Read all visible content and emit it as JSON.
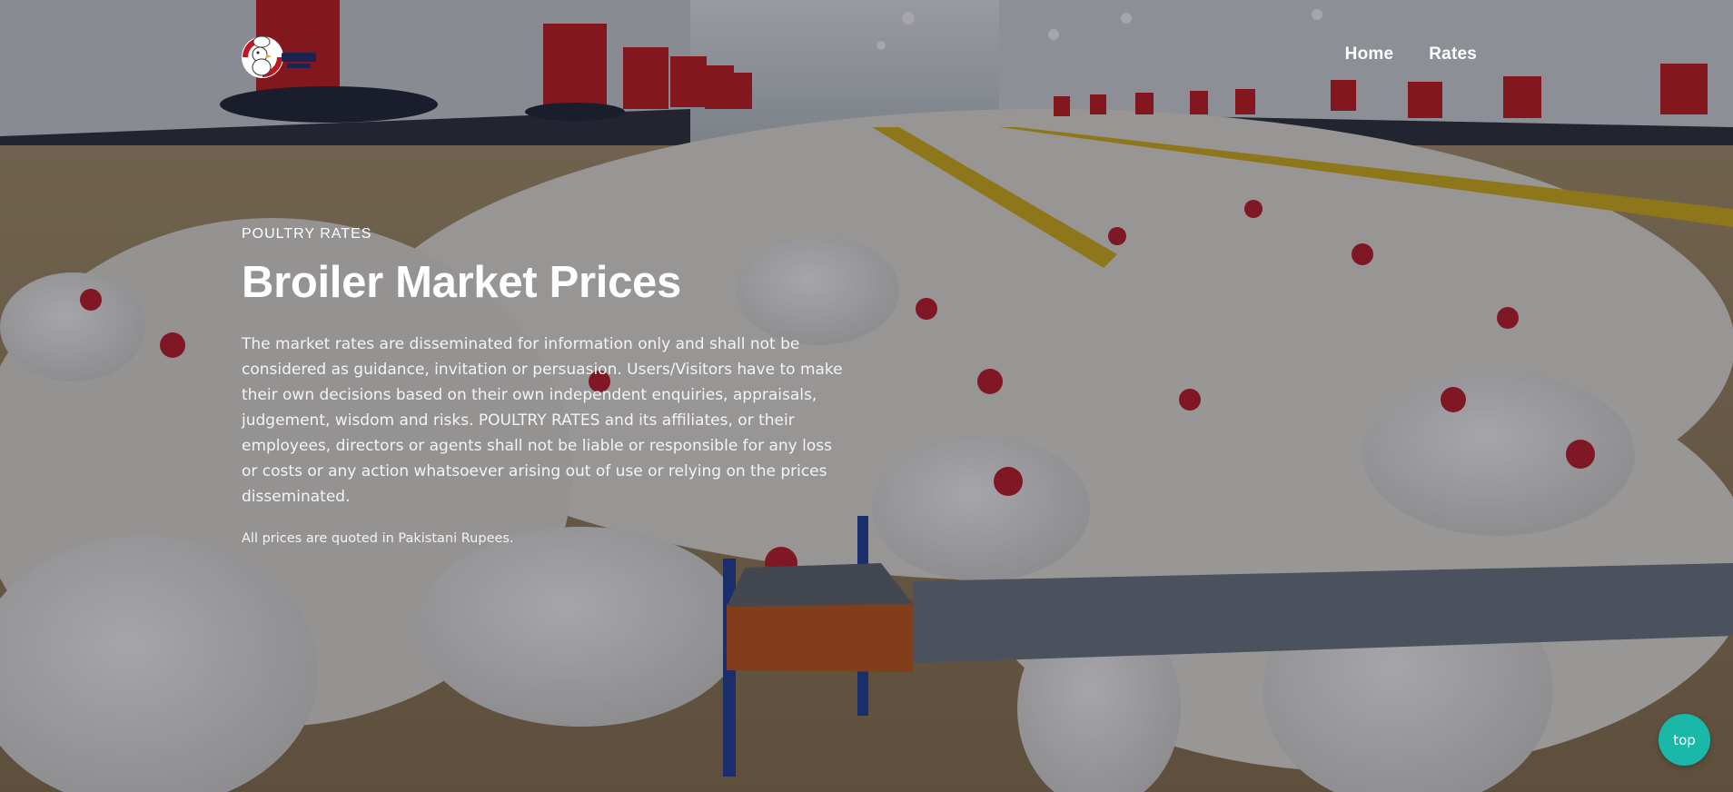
{
  "nav": {
    "logo_icon": "chicken-chef-logo",
    "links": [
      {
        "label": "Home"
      },
      {
        "label": "Rates"
      }
    ]
  },
  "hero": {
    "eyebrow": "POULTRY RATES",
    "title": "Broiler Market Prices",
    "disclaimer": "The market rates are disseminated for information only and shall not be considered as guidance, invitation or persuasion. Users/Visitors have to make their own decisions based on their own independent enquiries, appraisals, judgement, wisdom and risks. POULTRY RATES and its affiliates, or their employees, directors or agents shall not be liable or responsible for any loss or costs or any action whatsoever arising out of use or relying on the prices disseminated.",
    "currency_note": "All prices are quoted in Pakistani Rupees.",
    "background_image": "poultry-farm-broiler-chickens"
  },
  "scroll_top": {
    "label": "top"
  },
  "colors": {
    "accent": "#19b8a8",
    "text": "#ffffff"
  }
}
